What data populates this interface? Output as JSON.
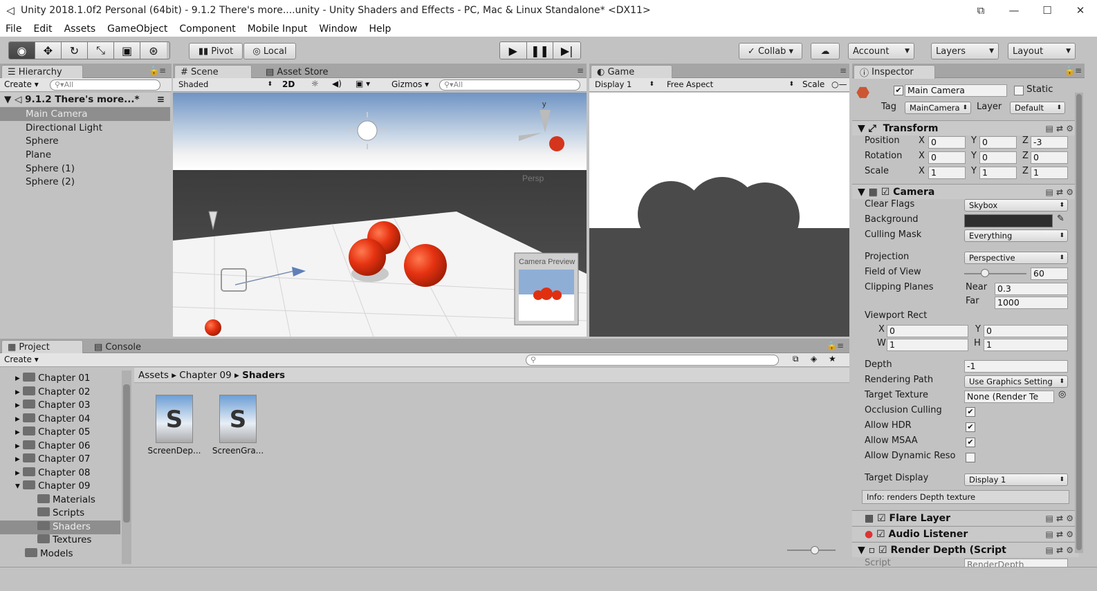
{
  "window": {
    "title": "Unity 2018.1.0f2 Personal (64bit) - 9.1.2 There's more....unity - Unity Shaders and Effects - PC, Mac & Linux Standalone* <DX11>"
  },
  "menu": [
    "File",
    "Edit",
    "Assets",
    "GameObject",
    "Component",
    "Mobile Input",
    "Window",
    "Help"
  ],
  "toolbar": {
    "pivot": "Pivot",
    "local": "Local",
    "collab": "Collab",
    "account": "Account",
    "layers": "Layers",
    "layout": "Layout"
  },
  "hierarchy": {
    "tab": "Hierarchy",
    "create": "Create",
    "search": "All",
    "scene": "9.1.2 There's more...*",
    "items": [
      "Main Camera",
      "Directional Light",
      "Sphere",
      "Plane",
      "Sphere (1)",
      "Sphere (2)"
    ]
  },
  "scene": {
    "tab": "Scene",
    "asset_store_tab": "Asset Store",
    "shade_mode": "Shaded",
    "mode_2d": "2D",
    "gizmos": "Gizmos",
    "search": "All",
    "persp": "Persp",
    "camera_preview": "Camera Preview"
  },
  "game": {
    "tab": "Game",
    "display": "Display 1",
    "aspect": "Free Aspect",
    "scale": "Scale"
  },
  "inspector": {
    "tab": "Inspector",
    "object_name": "Main Camera",
    "static": "Static",
    "tag_label": "Tag",
    "tag": "MainCamera",
    "layer_label": "Layer",
    "layer": "Default",
    "transform": {
      "title": "Transform",
      "position": {
        "label": "Position",
        "x": "0",
        "y": "0",
        "z": "-3"
      },
      "rotation": {
        "label": "Rotation",
        "x": "0",
        "y": "0",
        "z": "0"
      },
      "scale": {
        "label": "Scale",
        "x": "1",
        "y": "1",
        "z": "1"
      }
    },
    "camera": {
      "title": "Camera",
      "clear_flags": {
        "label": "Clear Flags",
        "value": "Skybox"
      },
      "background": {
        "label": "Background"
      },
      "culling_mask": {
        "label": "Culling Mask",
        "value": "Everything"
      },
      "projection": {
        "label": "Projection",
        "value": "Perspective"
      },
      "fov": {
        "label": "Field of View",
        "value": "60"
      },
      "clipping": {
        "label": "Clipping Planes",
        "near_label": "Near",
        "near": "0.3",
        "far_label": "Far",
        "far": "1000"
      },
      "viewport": {
        "label": "Viewport Rect",
        "x": "0",
        "y": "0",
        "w": "1",
        "h": "1"
      },
      "depth": {
        "label": "Depth",
        "value": "-1"
      },
      "rendering_path": {
        "label": "Rendering Path",
        "value": "Use Graphics Setting"
      },
      "target_texture": {
        "label": "Target Texture",
        "value": "None (Render Te"
      },
      "occlusion": {
        "label": "Occlusion Culling"
      },
      "hdr": {
        "label": "Allow HDR"
      },
      "msaa": {
        "label": "Allow MSAA"
      },
      "dyn_res": {
        "label": "Allow Dynamic Reso"
      },
      "target_display": {
        "label": "Target Display",
        "value": "Display 1"
      },
      "info": "Info: renders Depth texture"
    },
    "flare": "Flare Layer",
    "audio": "Audio Listener",
    "render_depth": "Render Depth (Script",
    "script_label": "Script",
    "script_value": "RenderDepth"
  },
  "project": {
    "tab": "Project",
    "console_tab": "Console",
    "create": "Create",
    "folders": [
      "Chapter 01",
      "Chapter 02",
      "Chapter 03",
      "Chapter 04",
      "Chapter 05",
      "Chapter 06",
      "Chapter 07",
      "Chapter 08",
      "Chapter 09"
    ],
    "subfolders": [
      "Materials",
      "Scripts",
      "Shaders",
      "Textures"
    ],
    "models": "Models",
    "breadcrumb": [
      "Assets",
      "Chapter 09",
      "Shaders"
    ],
    "assets": [
      "ScreenDep...",
      "ScreenGra..."
    ]
  },
  "colors": {
    "panel": "#c2c2c2",
    "selected": "#8e8e8e",
    "sphere": "#e03010",
    "sky_top": "#6f94c4",
    "ground": "#4a4a4a"
  }
}
